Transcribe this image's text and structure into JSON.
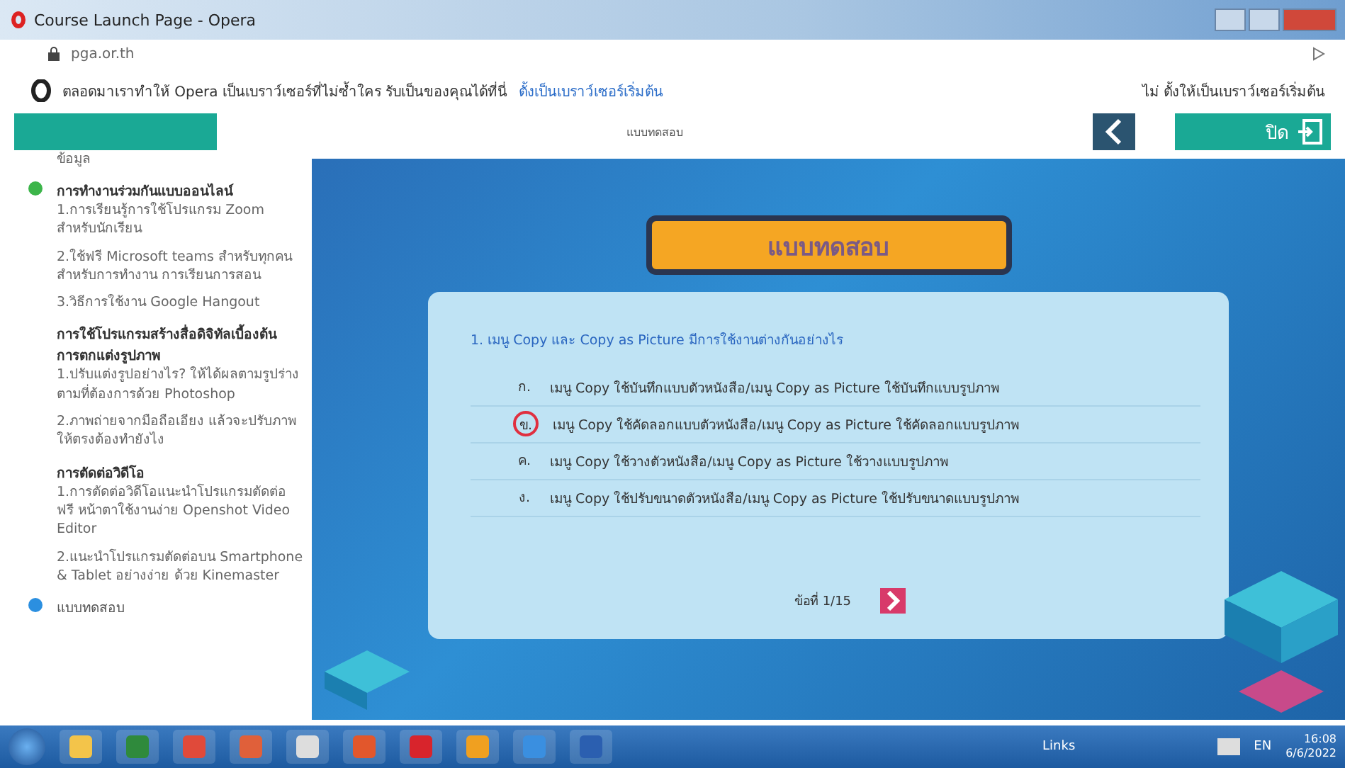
{
  "window": {
    "title": "Course Launch Page - Opera"
  },
  "address_bar": {
    "url": "pga.or.th"
  },
  "promo_bar": {
    "message": "ตลอดมาเราทำให้ Opera เป็นเบราว์เซอร์ที่ไม่ซ้ำใคร รับเป็นของคุณได้ที่นี่",
    "link": "ตั้งเป็นเบราว์เซอร์เริ่มต้น",
    "right_text": "ไม่ ตั้งให้เป็นเบราว์เซอร์เริ่มต้น"
  },
  "header": {
    "title": "แบบทดสอบ",
    "close_label": "ปิด"
  },
  "sidebar": {
    "top_item": "ข้อมูล",
    "sections": [
      {
        "title": "การทำงานร่วมกันแบบออนไลน์",
        "color": "#3cb54a",
        "items": [
          "1.การเรียนรู้การใช้โปรแกรม Zoom สำหรับนักเรียน",
          "2.ใช้ฟรี Microsoft teams สำหรับทุกคน สำหรับการทำงาน การเรียนการสอน",
          "3.วิธีการใช้งาน Google Hangout"
        ]
      },
      {
        "title": "การใช้โปรแกรมสร้างสื่อดิจิทัลเบื้องต้น การตกแต่งรูปภาพ",
        "items": [
          "1.ปรับแต่งรูปอย่างไร? ให้ได้ผลตามรูปร่างตามที่ต้องการด้วย Photoshop",
          "2.ภาพถ่ายจากมือถือเอียง แล้วจะปรับภาพให้ตรงต้องทำยังไง"
        ]
      },
      {
        "title": "การตัดต่อวิดีโอ",
        "items": [
          "1.การตัดต่อวิดีโอแนะนำโปรแกรมตัดต่อฟรี หน้าตาใช้งานง่าย Openshot Video Editor",
          "2.แนะนำโปรแกรมตัดต่อบน Smartphone & Tablet อย่างง่าย ด้วย Kinemaster"
        ]
      },
      {
        "title": "แบบทดสอบ",
        "color": "#2b8fe0"
      }
    ]
  },
  "quiz": {
    "banner": "แบบทดสอบ",
    "question": "1. เมนู Copy และ Copy as Picture มีการใช้งานต่างกันอย่างไร",
    "options": [
      {
        "label": "ก.",
        "text": "เมนู Copy ใช้บันทึกแบบตัวหนังสือ/เมนู Copy as Picture ใช้บันทึกแบบรูปภาพ",
        "selected": false
      },
      {
        "label": "ข.",
        "text": "เมนู Copy ใช้คัดลอกแบบตัวหนังสือ/เมนู Copy as Picture ใช้คัดลอกแบบรูปภาพ",
        "selected": true
      },
      {
        "label": "ค.",
        "text": "เมนู Copy ใช้วางตัวหนังสือ/เมนู Copy as Picture ใช้วางแบบรูปภาพ",
        "selected": false
      },
      {
        "label": "ง.",
        "text": "เมนู Copy ใช้ปรับขนาดตัวหนังสือ/เมนู Copy as Picture ใช้ปรับขนาดแบบรูปภาพ",
        "selected": false
      }
    ],
    "progress": "ข้อที่ 1/15"
  },
  "taskbar": {
    "links": "Links",
    "language": "EN",
    "time": "16:08",
    "date": "6/6/2022"
  }
}
